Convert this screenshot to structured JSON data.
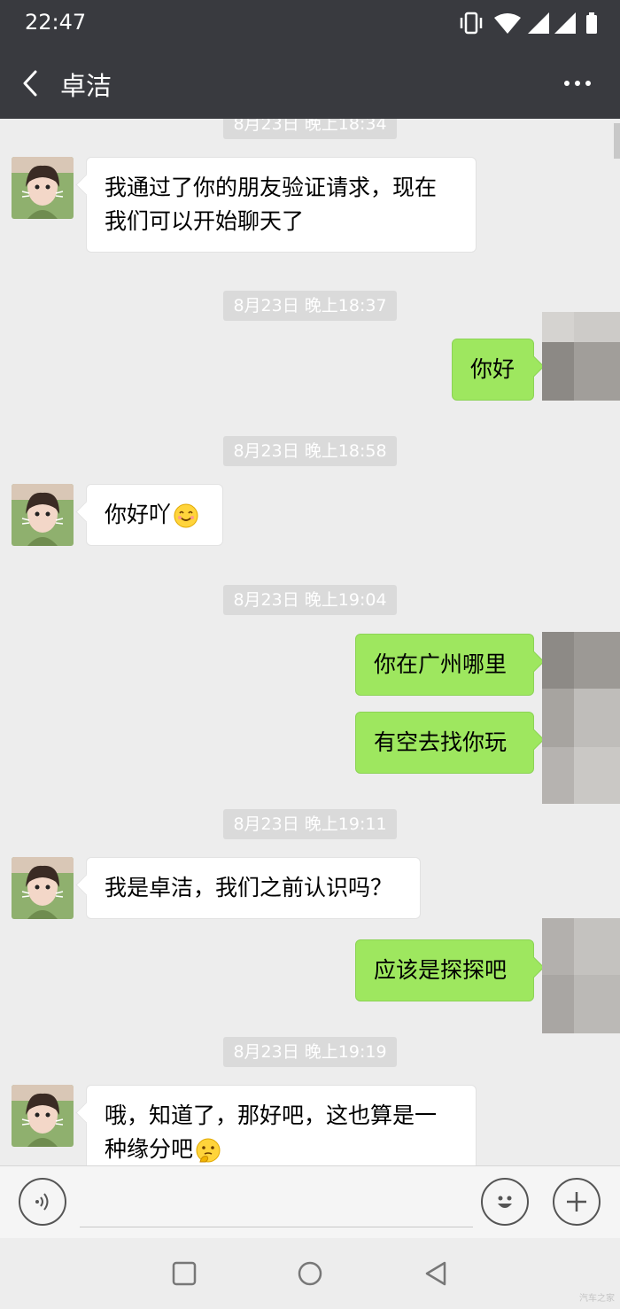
{
  "status_bar": {
    "time": "22:47"
  },
  "header": {
    "title": "卓洁"
  },
  "messages": [
    {
      "time": "8月23日 晚上18:34"
    },
    {
      "from": "them",
      "text": "我通过了你的朋友验证请求，现在我们可以开始聊天了"
    },
    {
      "time": "8月23日 晚上18:37"
    },
    {
      "from": "me",
      "text": "你好"
    },
    {
      "time": "8月23日 晚上18:58"
    },
    {
      "from": "them",
      "text": "你好吖",
      "emoji": "smiling-face-icon"
    },
    {
      "time": "8月23日 晚上19:04"
    },
    {
      "from": "me",
      "text": "你在广州哪里"
    },
    {
      "from": "me",
      "text": "有空去找你玩"
    },
    {
      "time": "8月23日 晚上19:11"
    },
    {
      "from": "them",
      "text": "我是卓洁，我们之前认识吗？"
    },
    {
      "from": "me",
      "text": "应该是探探吧"
    },
    {
      "time": "8月23日 晚上19:19"
    },
    {
      "from": "them",
      "text": "哦，知道了，那好吧，这也算是一种缘分吧",
      "emoji": "thinking-face-icon"
    }
  ],
  "input": {
    "placeholder": ""
  },
  "watermark": "汽车之家",
  "colors": {
    "header_bg": "#393a3f",
    "outgoing_bubble": "#9ee75f",
    "incoming_bubble": "#ffffff",
    "chat_bg": "#ededed"
  }
}
